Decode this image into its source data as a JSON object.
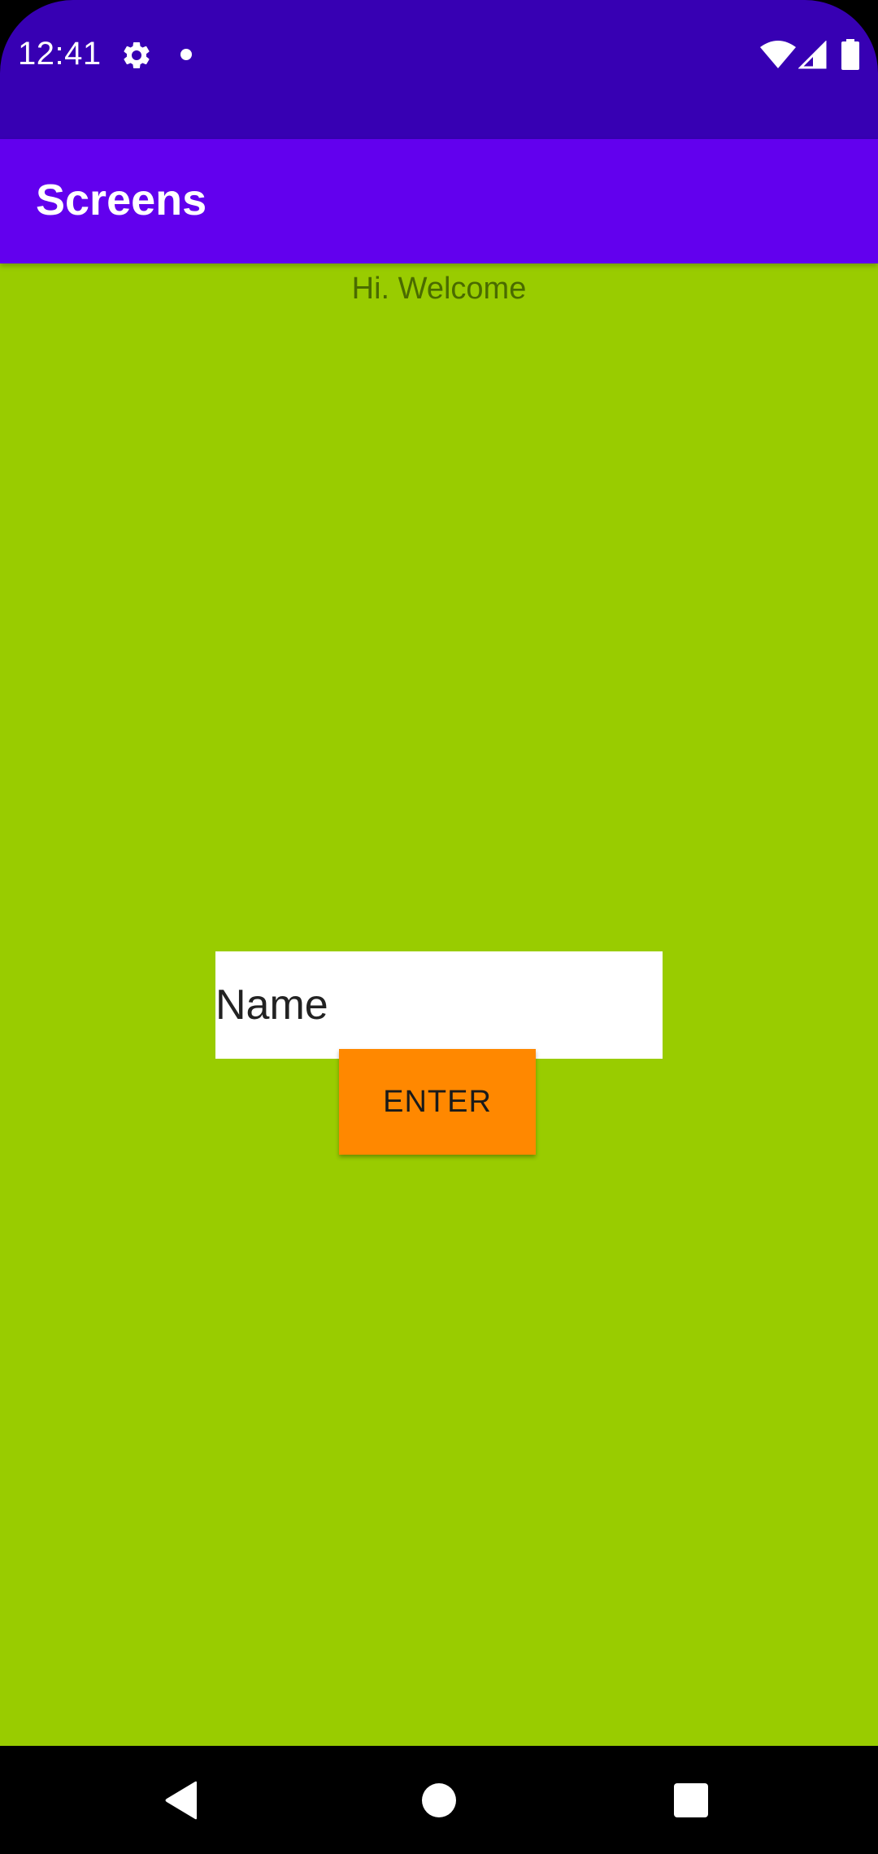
{
  "status_bar": {
    "time": "12:41",
    "icons": [
      "gear-icon",
      "notification-dot-icon",
      "wifi-icon",
      "signal-icon",
      "battery-icon"
    ],
    "background": "#3700B3"
  },
  "app_bar": {
    "title": "Screens",
    "background": "#6200EE"
  },
  "content": {
    "background": "#99CC00",
    "welcome_text": "Hi. Welcome",
    "name_input": {
      "value": "",
      "placeholder": "Name"
    },
    "enter_button": {
      "label": "ENTER",
      "color": "#FF8800"
    }
  },
  "nav_bar": {
    "icons": [
      "back-icon",
      "home-icon",
      "recents-icon"
    ]
  }
}
